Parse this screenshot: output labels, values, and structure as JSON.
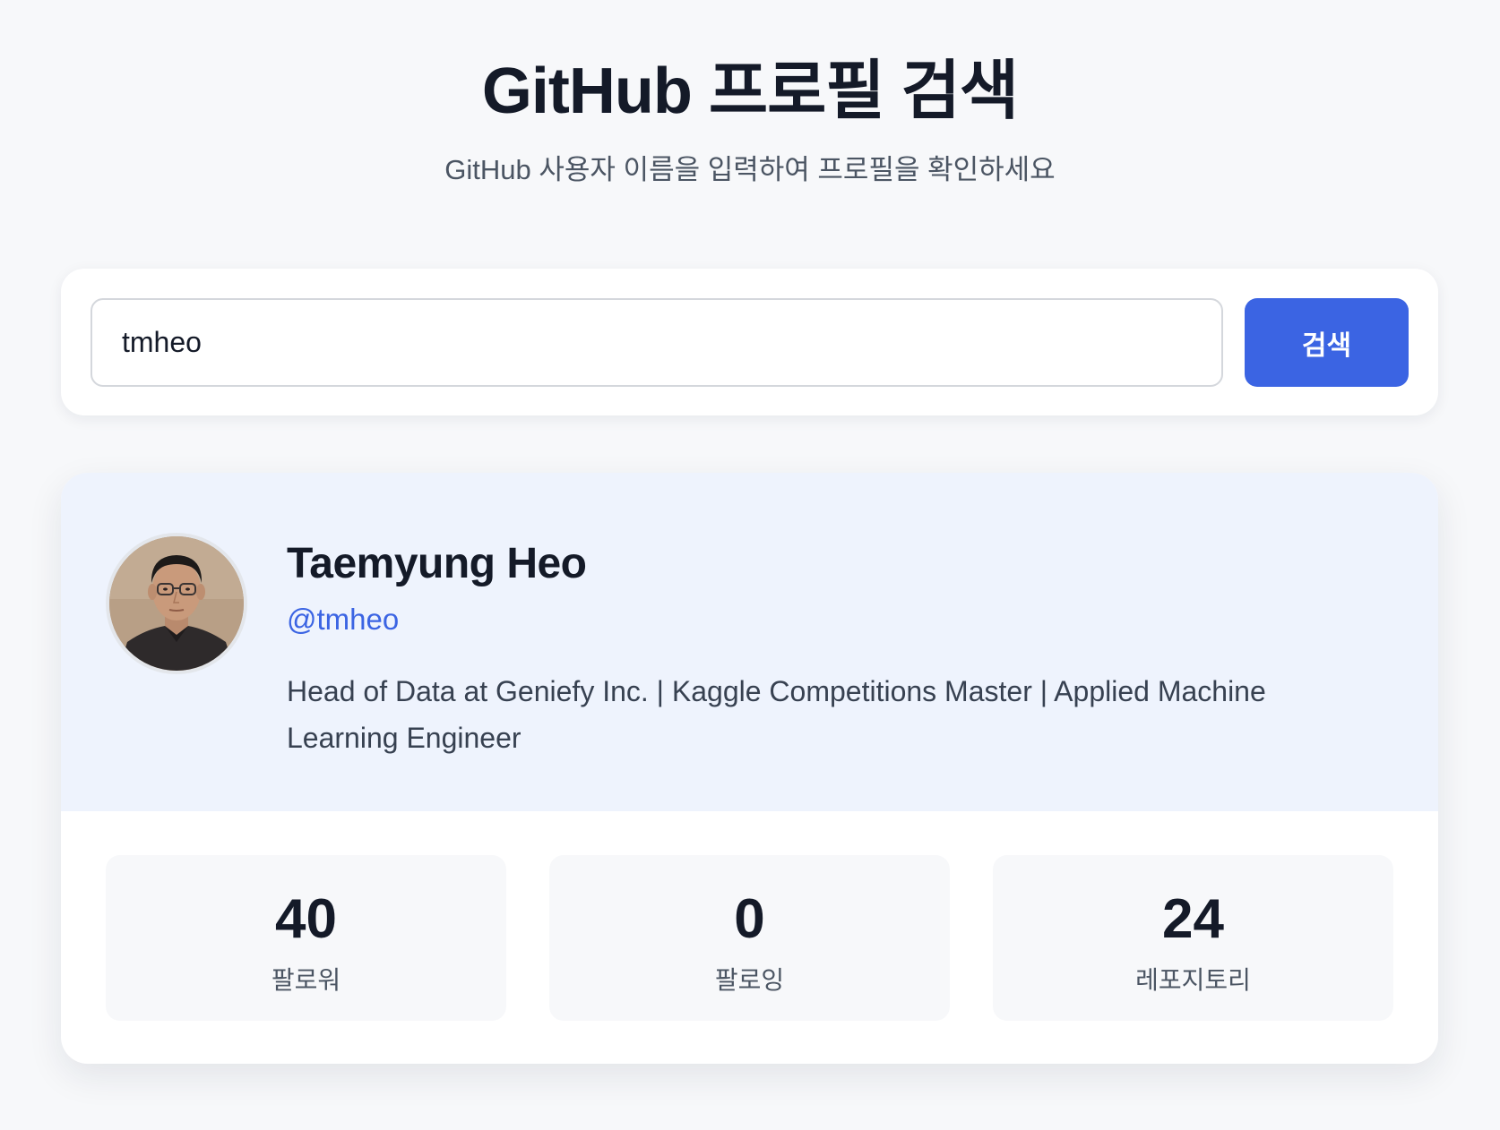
{
  "header": {
    "title": "GitHub 프로필 검색",
    "subtitle": "GitHub 사용자 이름을 입력하여 프로필을 확인하세요"
  },
  "search": {
    "value": "tmheo",
    "button_label": "검색"
  },
  "profile": {
    "name": "Taemyung Heo",
    "username": "@tmheo",
    "bio": "Head of Data at Geniefy Inc. | Kaggle Competitions Master | Applied Machine Learning Engineer",
    "stats": [
      {
        "value": "40",
        "label": "팔로워"
      },
      {
        "value": "0",
        "label": "팔로잉"
      },
      {
        "value": "24",
        "label": "레포지토리"
      }
    ]
  },
  "colors": {
    "accent": "#3b64e3",
    "profile_header_bg": "#eef3fd",
    "page_bg": "#f7f8fa"
  }
}
